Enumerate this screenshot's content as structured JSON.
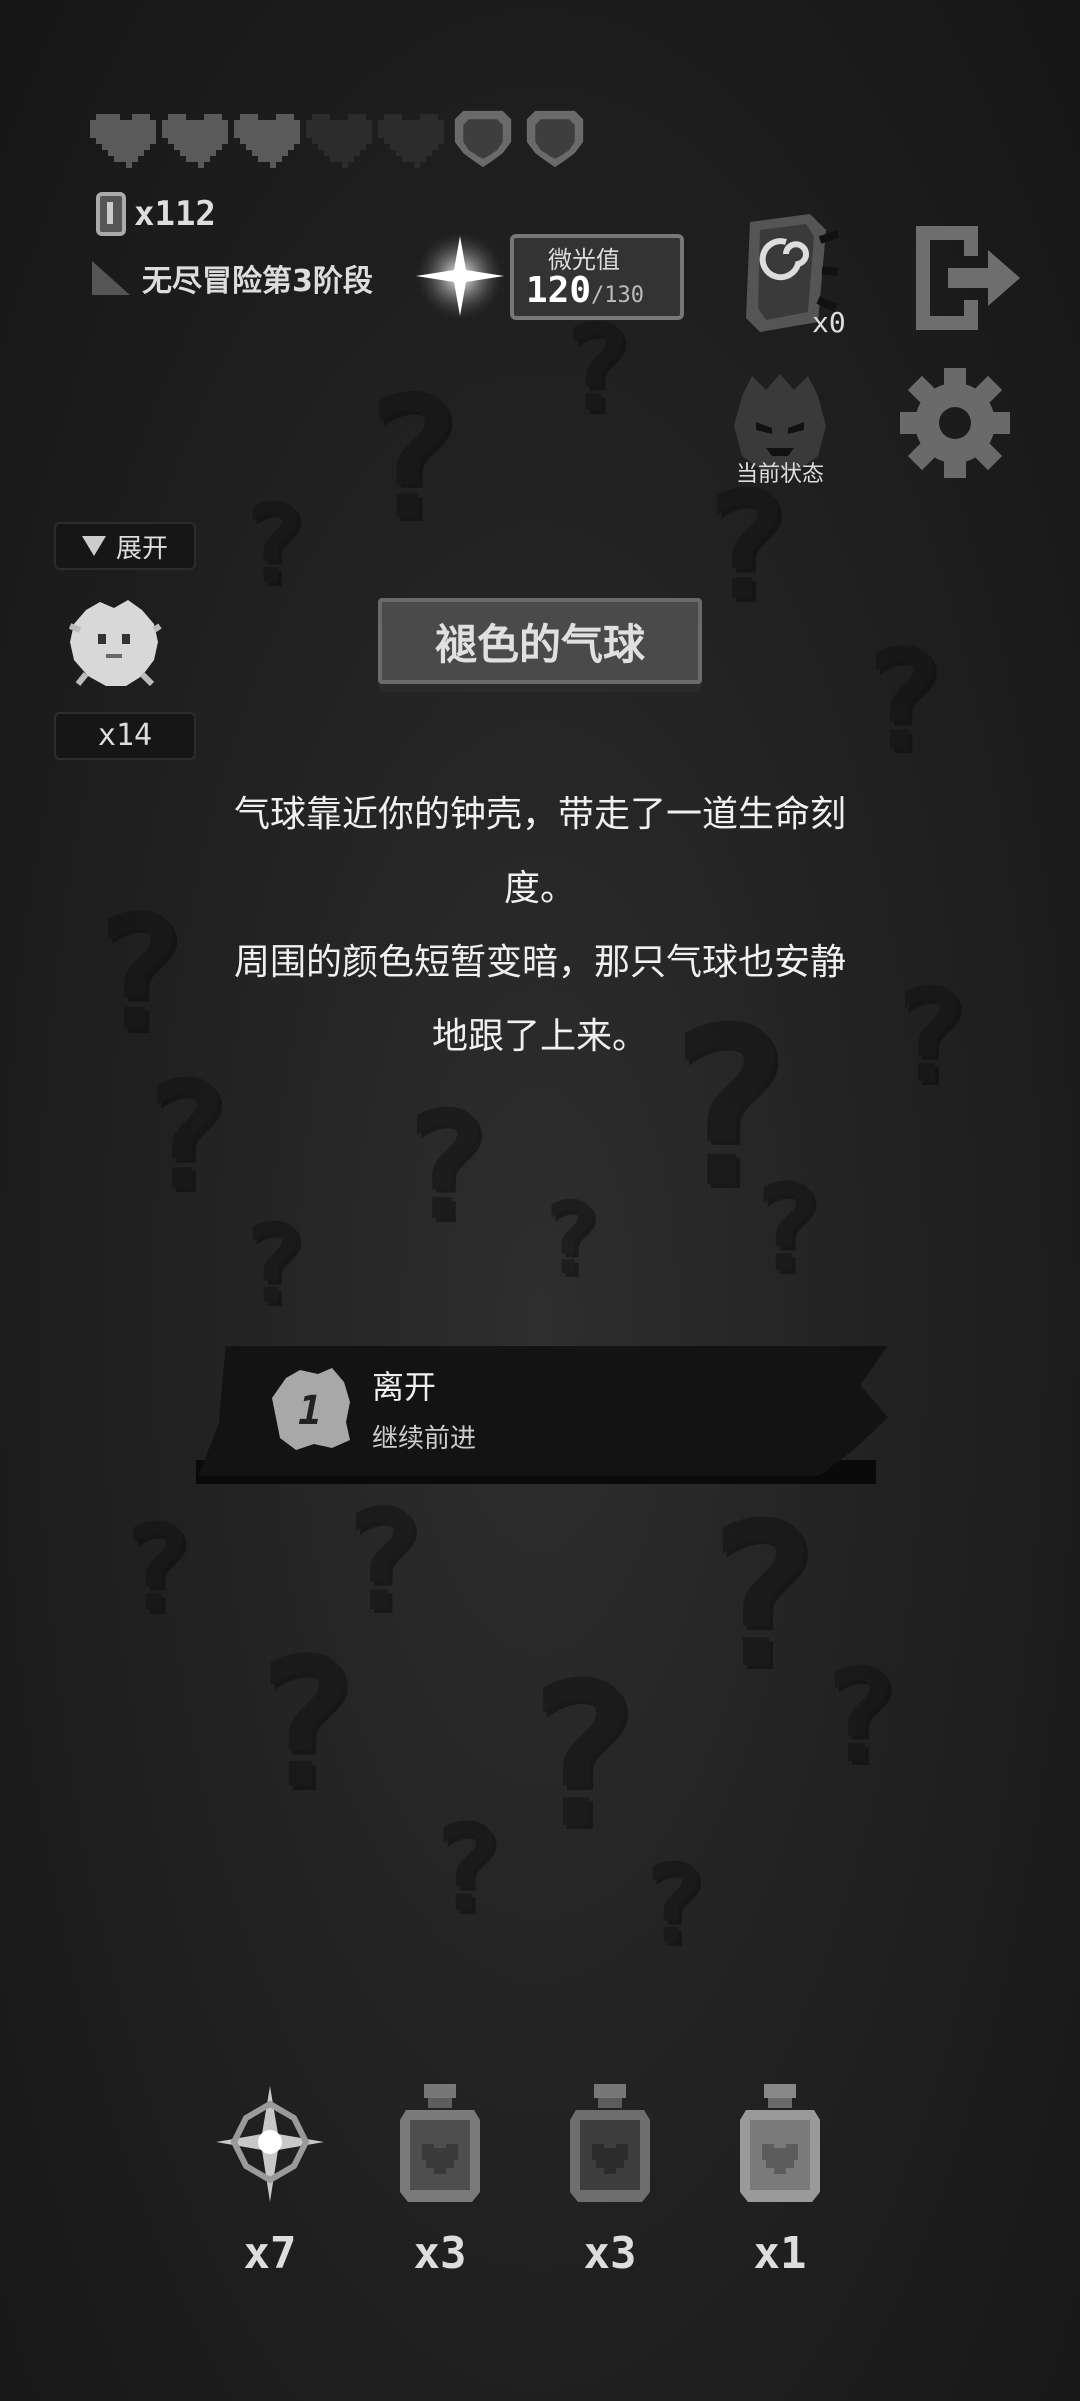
{
  "hud": {
    "hearts_full": 3,
    "hearts_empty": 2,
    "shields": 2,
    "coins_label": "x112",
    "stage_label": "无尽冒险第3阶段",
    "glow": {
      "title": "微光值",
      "value": "120",
      "max": "/130"
    },
    "swirl_count": "x0",
    "status_label": "当前状态"
  },
  "side_panel": {
    "expand_label": "展开",
    "pet_count": "x14"
  },
  "event": {
    "title": "褪色的气球",
    "description_lines": [
      "气球靠近你的钟壳，带走了一道生命刻",
      "度。",
      "周围的颜色短暂变暗，那只气球也安静",
      "地跟了上来。"
    ]
  },
  "choices": [
    {
      "number": "1",
      "label": "离开",
      "sublabel": "继续前进"
    }
  ],
  "items": [
    {
      "icon": "sparkle-star-icon",
      "count": "x7"
    },
    {
      "icon": "heart-potion-icon",
      "count": "x3"
    },
    {
      "icon": "heart-potion-icon",
      "count": "x3"
    },
    {
      "icon": "heart-potion-icon",
      "count": "x1"
    }
  ],
  "colors": {
    "background": "#1a1a1a",
    "heart_full": "#5a5a5a",
    "heart_empty": "#2c2c2c",
    "text": "#f0f0f0"
  }
}
